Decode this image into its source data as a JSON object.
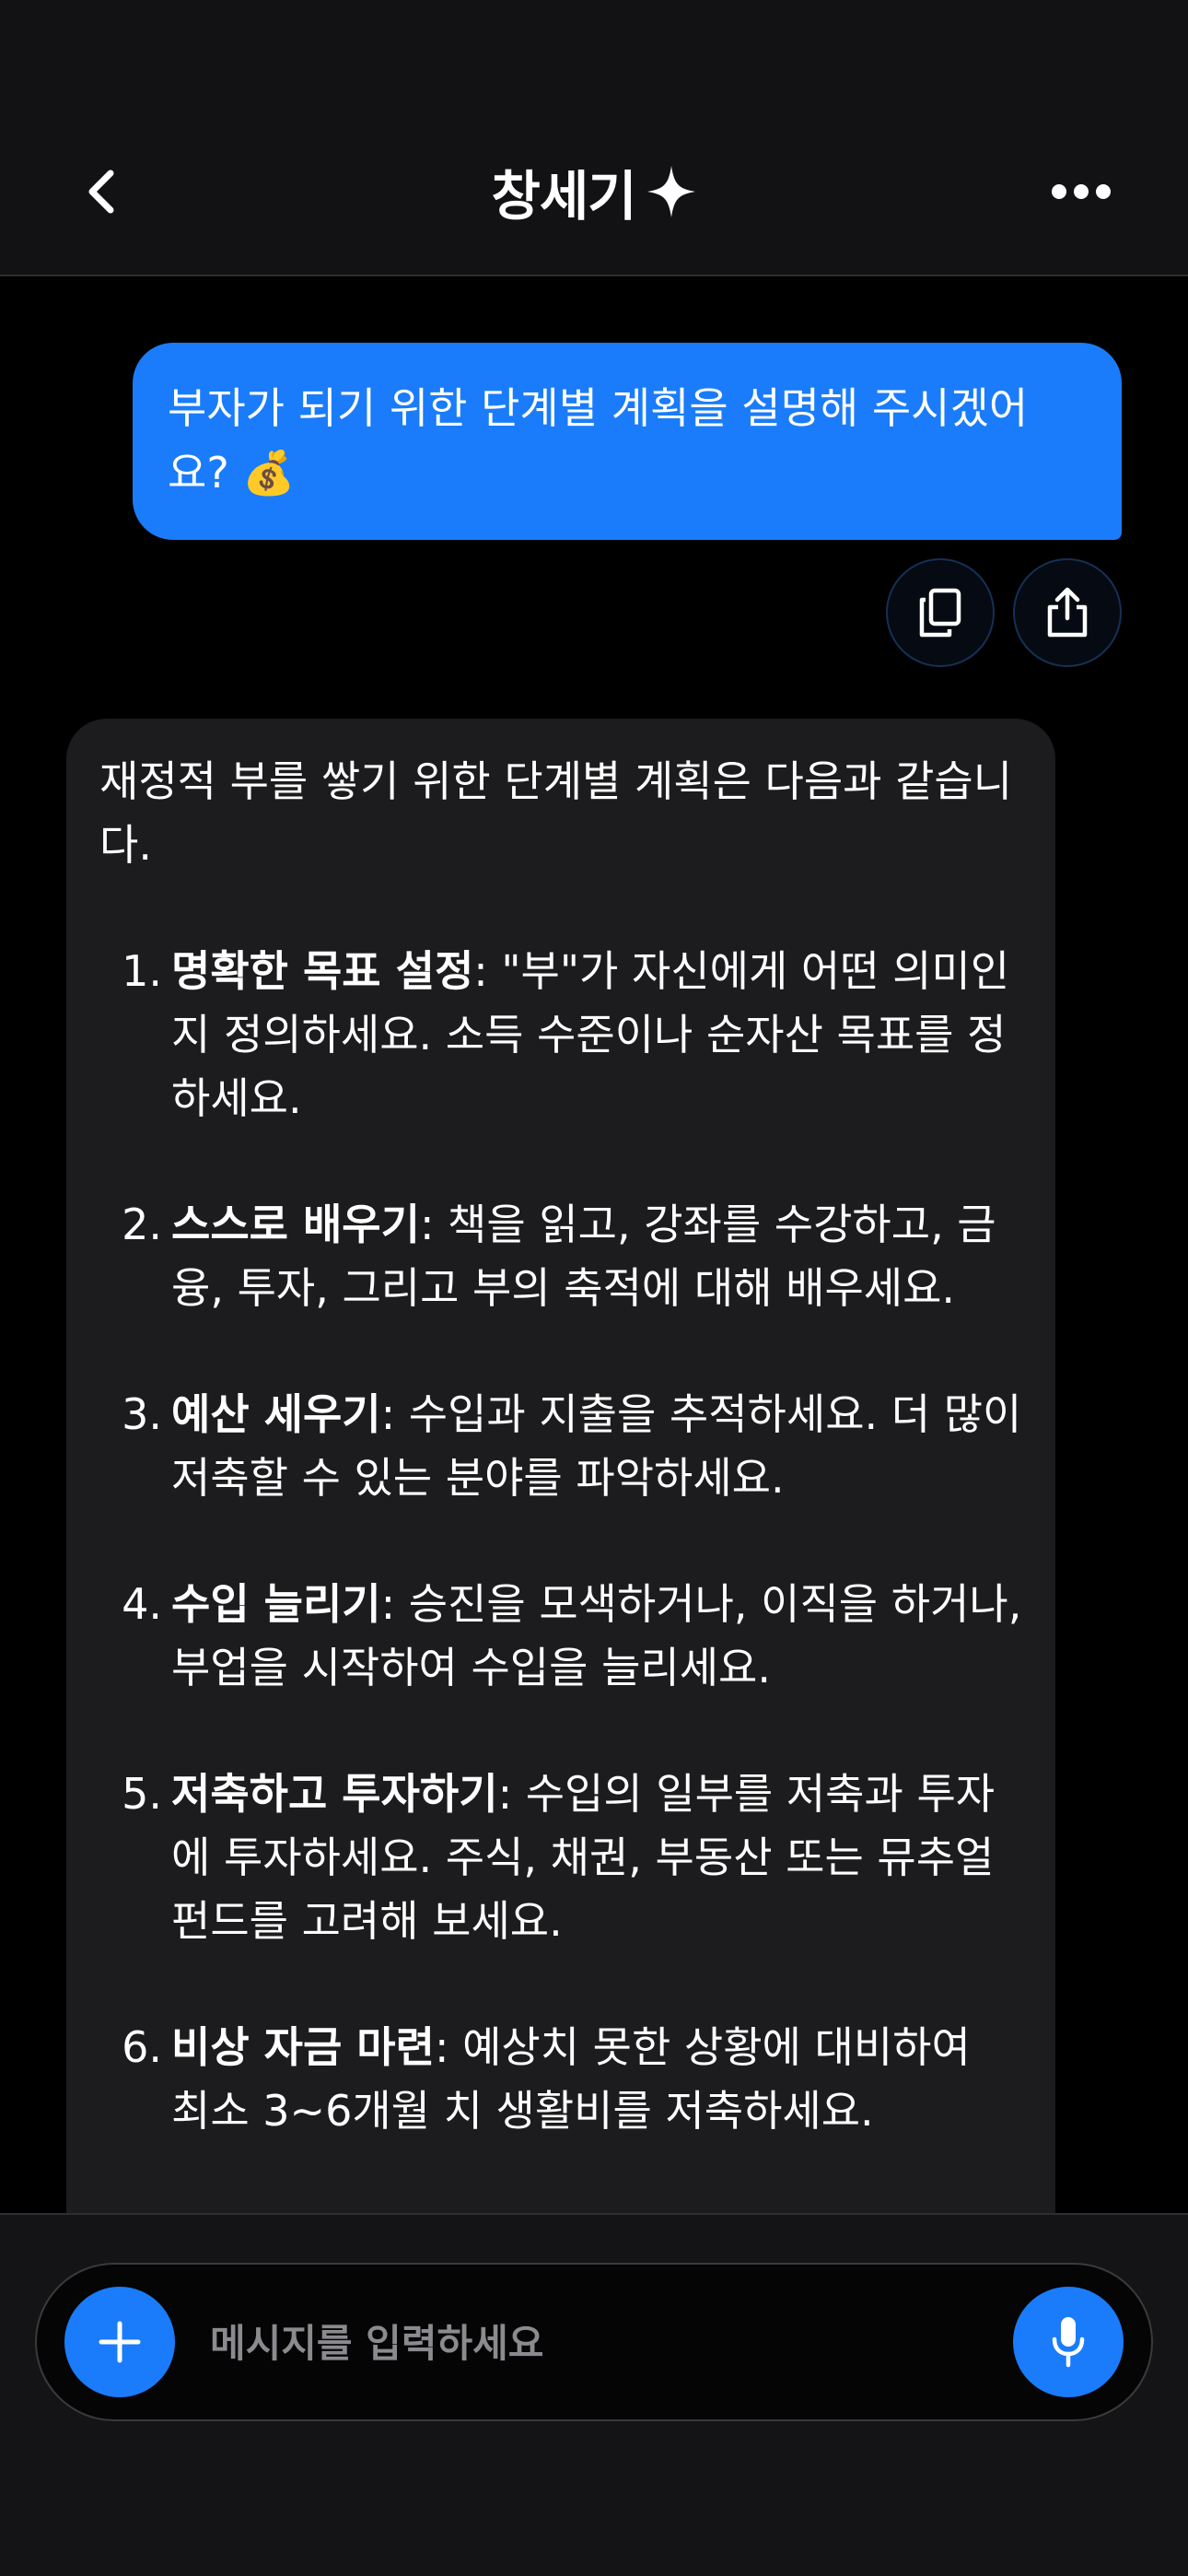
{
  "header": {
    "title": "창세기",
    "back_icon": "chevron-left-icon",
    "title_icon": "sparkle-icon",
    "more_icon": "ellipsis-icon"
  },
  "user_message": {
    "text": "부자가 되기 위한 단계별 계획을 설명해 주시겠어요? 💰",
    "actions": [
      {
        "icon": "copy-icon"
      },
      {
        "icon": "share-icon"
      }
    ]
  },
  "assistant_message": {
    "intro": "재정적 부를 쌓기 위한 단계별 계획은 다음과 같습니다.",
    "steps": [
      {
        "num": "1.",
        "title": "명확한 목표 설정",
        "text": ": \"부\"가 자신에게 어떤 의미인지 정의하세요. 소득 수준이나 순자산 목표를 정하세요."
      },
      {
        "num": "2.",
        "title": "스스로 배우기",
        "text": ": 책을 읽고, 강좌를 수강하고, 금융, 투자, 그리고 부의 축적에 대해 배우세요."
      },
      {
        "num": "3.",
        "title": "예산 세우기",
        "text": ": 수입과 지출을 추적하세요. 더 많이 저축할 수 있는 분야를 파악하세요."
      },
      {
        "num": "4.",
        "title": "수입 늘리기",
        "text": ": 승진을 모색하거나, 이직을 하거나, 부업을 시작하여 수입을 늘리세요."
      },
      {
        "num": "5.",
        "title": "저축하고 투자하기",
        "text": ": 수입의 일부를 저축과 투자에 투자하세요. 주식, 채권, 부동산 또는 뮤추얼 펀드를 고려해 보세요."
      },
      {
        "num": "6.",
        "title": "비상 자금 마련",
        "text": ": 예상치 못한 상황에 대비하여 최소 3~6개월 치 생활비를 저축하세요."
      }
    ]
  },
  "composer": {
    "placeholder": "메시지를 입력하세요",
    "value": "",
    "plus_icon": "plus-icon",
    "mic_icon": "microphone-icon"
  },
  "colors": {
    "accent": "#1a7cfa",
    "background": "#000000",
    "header_bg": "#121214",
    "assistant_bubble": "#1c1c1e"
  }
}
